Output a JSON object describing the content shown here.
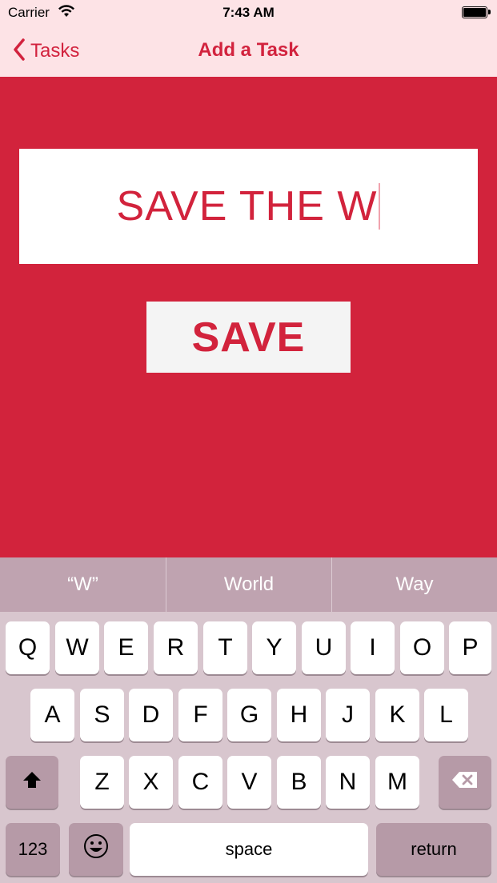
{
  "status_bar": {
    "carrier": "Carrier",
    "time": "7:43 AM"
  },
  "nav": {
    "back_label": "Tasks",
    "title": "Add a Task"
  },
  "form": {
    "task_value": "SAVE THE W",
    "save_label": "SAVE"
  },
  "keyboard": {
    "suggestions": [
      "“W”",
      "World",
      "Way"
    ],
    "row1": [
      "Q",
      "W",
      "E",
      "R",
      "T",
      "Y",
      "U",
      "I",
      "O",
      "P"
    ],
    "row2": [
      "A",
      "S",
      "D",
      "F",
      "G",
      "H",
      "J",
      "K",
      "L"
    ],
    "row3": [
      "Z",
      "X",
      "C",
      "V",
      "B",
      "N",
      "M"
    ],
    "numbers_label": "123",
    "space_label": "space",
    "return_label": "return"
  },
  "colors": {
    "accent": "#d2233c",
    "nav_background": "#fde3e6",
    "keyboard_background": "#d8c6ce"
  }
}
